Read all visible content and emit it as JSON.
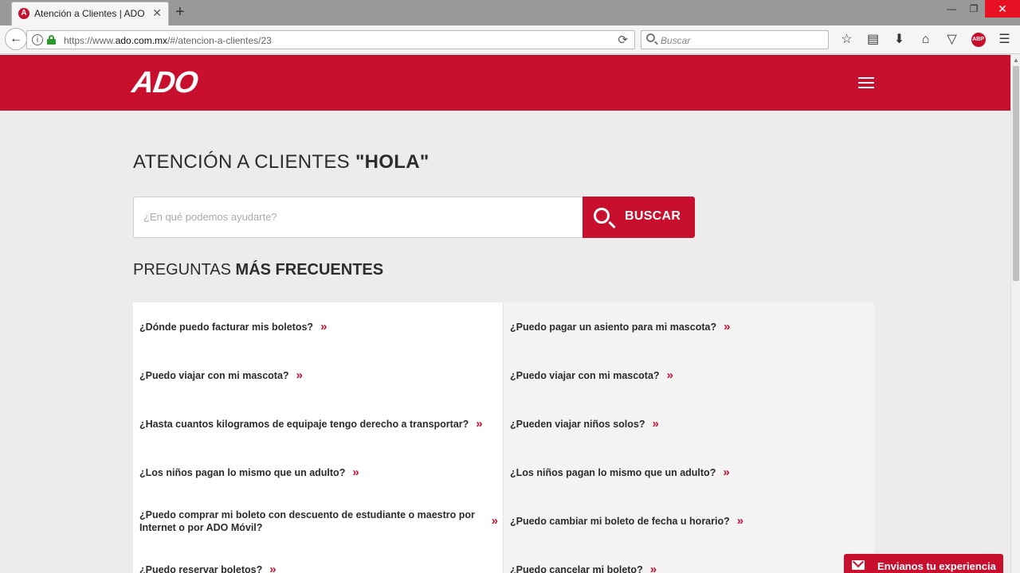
{
  "browser": {
    "tab_title": "Atención a Clientes | ADO",
    "tab_close": "✕",
    "new_tab": "+",
    "url_prefix": "https://www.",
    "url_domain": "ado.com.mx",
    "url_path": "/#/atencion-a-clientes/23",
    "search_placeholder": "Buscar",
    "win_minimize": "—",
    "win_restore": "❐",
    "win_close": "✕",
    "toolbar": [
      "star-icon",
      "reading-list-icon",
      "download-icon",
      "home-icon",
      "pocket-icon",
      "adblock-icon",
      "menu-icon"
    ],
    "abp_label": "ABP"
  },
  "header": {
    "logo": "ADO",
    "brand_color": "#c8102e"
  },
  "main": {
    "title_prefix": "ATENCIÓN A CLIENTES ",
    "title_query": "\"HOLA\"",
    "search_placeholder": "¿En qué podemos ayudarte?",
    "search_button": "BUSCAR",
    "faq_title_prefix": "PREGUNTAS ",
    "faq_title_bold": "MÁS FRECUENTES",
    "faq_rows": [
      {
        "left": "¿Dónde puedo facturar mis boletos?",
        "right": "¿Puedo pagar un asiento para mi mascota?"
      },
      {
        "left": "¿Puedo viajar con mi mascota?",
        "right": "¿Puedo viajar con mi mascota?"
      },
      {
        "left": "¿Hasta cuantos kilogramos de equipaje tengo derecho a transportar?",
        "right": "¿Pueden viajar niños solos?"
      },
      {
        "left": "¿Los niños pagan lo mismo que un adulto?",
        "right": "¿Los niños pagan lo mismo que un adulto?"
      },
      {
        "left": "¿Puedo comprar mi boleto con descuento de estudiante o maestro por Internet o por ADO Móvil?",
        "right": "¿Puedo cambiar mi boleto de fecha u horario?"
      },
      {
        "left": "¿Puedo reservar boletos?",
        "right": "¿Puedo cancelar mi boleto?"
      }
    ],
    "chevron": "»",
    "feedback_label": "Envianos tu experiencia"
  }
}
